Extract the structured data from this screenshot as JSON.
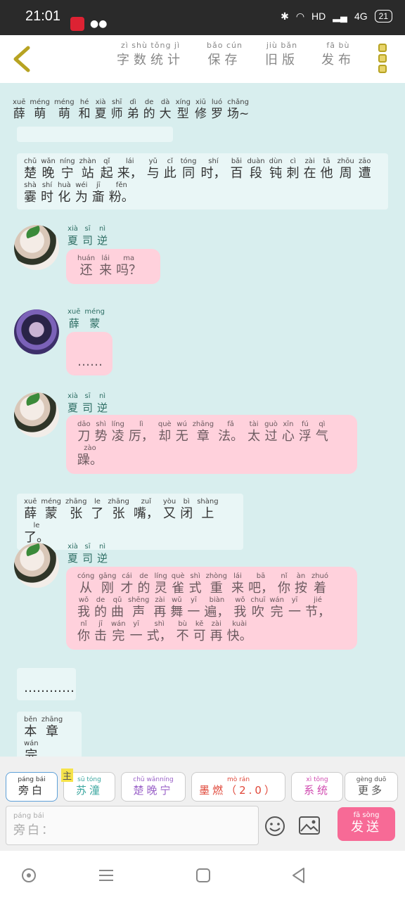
{
  "status": {
    "time": "21:01",
    "network": "HD",
    "signal": "4G",
    "battery": "21"
  },
  "header": {
    "menu": [
      {
        "py": "zì shù tǒng jì",
        "hz": "字数统计"
      },
      {
        "py": "bǎo cún",
        "hz": "保存"
      },
      {
        "py": "jiù bǎn",
        "hz": "旧版"
      },
      {
        "py": "fā bù",
        "hz": "发布"
      }
    ]
  },
  "title": {
    "tokens": [
      {
        "py": "xuē",
        "hz": "薛"
      },
      {
        "py": "méng",
        "hz": "萌"
      },
      {
        "py": "méng",
        "hz": "萌"
      },
      {
        "py": "hé",
        "hz": "和"
      },
      {
        "py": "xià",
        "hz": "夏"
      },
      {
        "py": "shī",
        "hz": "师"
      },
      {
        "py": "dì",
        "hz": "弟"
      },
      {
        "py": "de",
        "hz": "的"
      },
      {
        "py": "dà",
        "hz": "大"
      },
      {
        "py": "xíng",
        "hz": "型"
      },
      {
        "py": "xiū",
        "hz": "修"
      },
      {
        "py": "luó",
        "hz": "罗"
      },
      {
        "py": "chǎng",
        "hz": "场~"
      }
    ]
  },
  "messages": {
    "narr1": [
      {
        "py": "chǔ",
        "hz": "楚"
      },
      {
        "py": "wǎn",
        "hz": "晚"
      },
      {
        "py": "níng",
        "hz": "宁"
      },
      {
        "py": "zhàn",
        "hz": "站"
      },
      {
        "py": "qǐ",
        "hz": "起"
      },
      {
        "py": "lái",
        "hz": "来，"
      },
      {
        "py": "yǔ",
        "hz": "与"
      },
      {
        "py": "cǐ",
        "hz": "此"
      },
      {
        "py": "tóng",
        "hz": "同"
      },
      {
        "py": "shí",
        "hz": "时，"
      },
      {
        "py": "bǎi",
        "hz": "百"
      },
      {
        "py": "duàn",
        "hz": "段"
      },
      {
        "py": "dùn",
        "hz": "钝"
      },
      {
        "py": "cì",
        "hz": "刺"
      },
      {
        "py": "zài",
        "hz": "在"
      },
      {
        "py": "tā",
        "hz": "他"
      },
      {
        "py": "zhōu",
        "hz": "周"
      },
      {
        "py": "zāo",
        "hz": "遭"
      },
      {
        "py": "shà",
        "hz": "霎"
      },
      {
        "py": "shí",
        "hz": "时"
      },
      {
        "py": "huà",
        "hz": "化"
      },
      {
        "py": "wéi",
        "hz": "为"
      },
      {
        "py": "jī",
        "hz": "齑"
      },
      {
        "py": "fěn",
        "hz": "粉。"
      }
    ],
    "name_xia": [
      {
        "py": "xià",
        "hz": "夏"
      },
      {
        "py": "sī",
        "hz": "司"
      },
      {
        "py": "nì",
        "hz": "逆"
      }
    ],
    "bubble1": [
      {
        "py": "huán",
        "hz": "还"
      },
      {
        "py": "lái",
        "hz": "来"
      },
      {
        "py": "ma",
        "hz": "吗？"
      }
    ],
    "name_xue": [
      {
        "py": "xuē",
        "hz": "薛"
      },
      {
        "py": "méng",
        "hz": "蒙"
      }
    ],
    "bubble2": [
      {
        "py": "",
        "hz": "……"
      }
    ],
    "bubble3": [
      {
        "py": "dāo",
        "hz": "刀"
      },
      {
        "py": "shì",
        "hz": "势"
      },
      {
        "py": "líng",
        "hz": "凌"
      },
      {
        "py": "lì",
        "hz": "厉，"
      },
      {
        "py": "què",
        "hz": "却"
      },
      {
        "py": "wú",
        "hz": "无"
      },
      {
        "py": "zhāng",
        "hz": "章"
      },
      {
        "py": "fǎ",
        "hz": "法。"
      },
      {
        "py": "tài",
        "hz": "太"
      },
      {
        "py": "guò",
        "hz": "过"
      },
      {
        "py": "xīn",
        "hz": "心"
      },
      {
        "py": "fú",
        "hz": "浮"
      },
      {
        "py": "qì",
        "hz": "气"
      },
      {
        "py": "zào",
        "hz": "躁。"
      }
    ],
    "narr2": [
      {
        "py": "xuē",
        "hz": "薛"
      },
      {
        "py": "méng",
        "hz": "蒙"
      },
      {
        "py": "zhāng",
        "hz": "张"
      },
      {
        "py": "le",
        "hz": "了"
      },
      {
        "py": "zhāng",
        "hz": "张"
      },
      {
        "py": "zuǐ",
        "hz": "嘴，"
      },
      {
        "py": "yòu",
        "hz": "又"
      },
      {
        "py": "bì",
        "hz": "闭"
      },
      {
        "py": "shàng",
        "hz": "上"
      },
      {
        "py": "le",
        "hz": "了。"
      }
    ],
    "bubble4": [
      {
        "py": "cóng",
        "hz": "从"
      },
      {
        "py": "gāng",
        "hz": "刚"
      },
      {
        "py": "cái",
        "hz": "才"
      },
      {
        "py": "de",
        "hz": "的"
      },
      {
        "py": "líng",
        "hz": "灵"
      },
      {
        "py": "què",
        "hz": "雀"
      },
      {
        "py": "shì",
        "hz": "式"
      },
      {
        "py": "zhòng",
        "hz": "重"
      },
      {
        "py": "lái",
        "hz": "来"
      },
      {
        "py": "bā",
        "hz": "吧，"
      },
      {
        "py": "nǐ",
        "hz": "你"
      },
      {
        "py": "àn",
        "hz": "按"
      },
      {
        "py": "zhuó",
        "hz": "着"
      },
      {
        "py": "wǒ",
        "hz": "我"
      },
      {
        "py": "de",
        "hz": "的"
      },
      {
        "py": "qǔ",
        "hz": "曲"
      },
      {
        "py": "shēng",
        "hz": "声"
      },
      {
        "py": "zài",
        "hz": "再"
      },
      {
        "py": "wǔ",
        "hz": "舞"
      },
      {
        "py": "yī",
        "hz": "一"
      },
      {
        "py": "biàn",
        "hz": "遍，"
      },
      {
        "py": "wǒ",
        "hz": "我"
      },
      {
        "py": "chuī",
        "hz": "吹"
      },
      {
        "py": "wán",
        "hz": "完"
      },
      {
        "py": "yī",
        "hz": "一"
      },
      {
        "py": "jié",
        "hz": "节，"
      },
      {
        "py": "nǐ",
        "hz": "你"
      },
      {
        "py": "jī",
        "hz": "击"
      },
      {
        "py": "wán",
        "hz": "完"
      },
      {
        "py": "yī",
        "hz": "一"
      },
      {
        "py": "shì",
        "hz": "式，"
      },
      {
        "py": "bù",
        "hz": "不"
      },
      {
        "py": "kě",
        "hz": "可"
      },
      {
        "py": "zài",
        "hz": "再"
      },
      {
        "py": "kuài",
        "hz": "快。"
      }
    ],
    "narr3": [
      {
        "py": "",
        "hz": "…………"
      }
    ],
    "narr4": [
      {
        "py": "běn",
        "hz": "本"
      },
      {
        "py": "zhāng",
        "hz": "章"
      },
      {
        "py": "wán",
        "hz": "完"
      }
    ]
  },
  "tabs": [
    {
      "py": "páng bái",
      "hz": "旁白",
      "color": "#333333"
    },
    {
      "py": "sū tóng",
      "hz": "苏潼",
      "color": "#3ba7a0",
      "badge": "主",
      "badge_py": "zhǔ"
    },
    {
      "py": "chǔ wǎnníng",
      "hz": "楚晚宁",
      "color": "#9a62c8"
    },
    {
      "py": "mò rán",
      "hz": "墨燃（2.0）",
      "color": "#e0483a"
    },
    {
      "py": "xì tǒng",
      "hz": "系统",
      "color": "#d04ab0"
    },
    {
      "py": "gèng duō",
      "hz": "更多",
      "color": "#555555"
    }
  ],
  "input": {
    "py": "páng bái",
    "hz": "旁白："
  },
  "send": {
    "py": "fā sòng",
    "hz": "发送"
  }
}
